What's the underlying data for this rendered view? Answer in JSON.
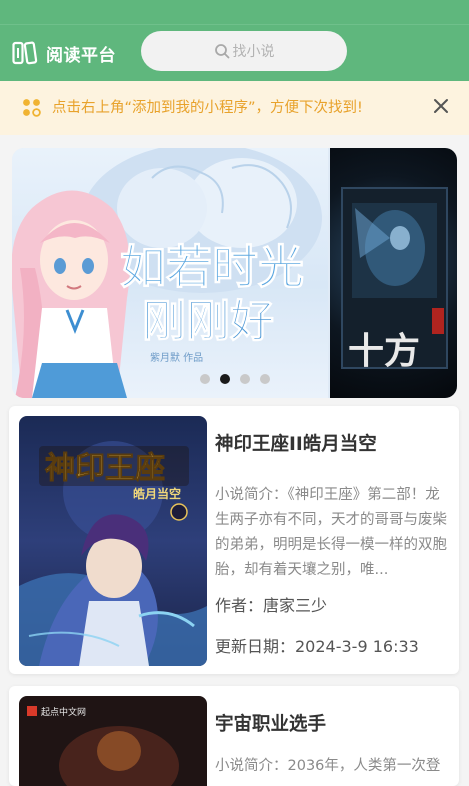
{
  "header": {
    "title": "阅读平台",
    "search_placeholder": "找小说",
    "bg_color": "#5fb77d"
  },
  "notice": {
    "text": "点击右上角“添加到我的小程序”，方便下次找到!",
    "color": "#e8a22b",
    "bg_color": "#fdf3df"
  },
  "banner": {
    "slide_titles": [
      "如若时光",
      "刚刚好"
    ],
    "slide_author": "紫月默 作品",
    "slide2_title": "十方",
    "slide_count": 4,
    "active_index": 1
  },
  "books": [
    {
      "title": "神印王座II皓月当空",
      "cover_title": "神印王座",
      "cover_subtitle": "皓月当空",
      "desc": "小说简介：《神印王座》第二部！龙生两子亦有不同，天才的哥哥与废柴的弟弟，明明是长得一模一样的双胞胎，却有着天壤之别，唯...",
      "author": "作者：唐家三少",
      "date": "更新日期：2024-3-9 16:33"
    },
    {
      "title": "宇宙职业选手",
      "cover_badge": "起点中文网",
      "desc": "小说简介：2036年，人类第一次登"
    }
  ]
}
